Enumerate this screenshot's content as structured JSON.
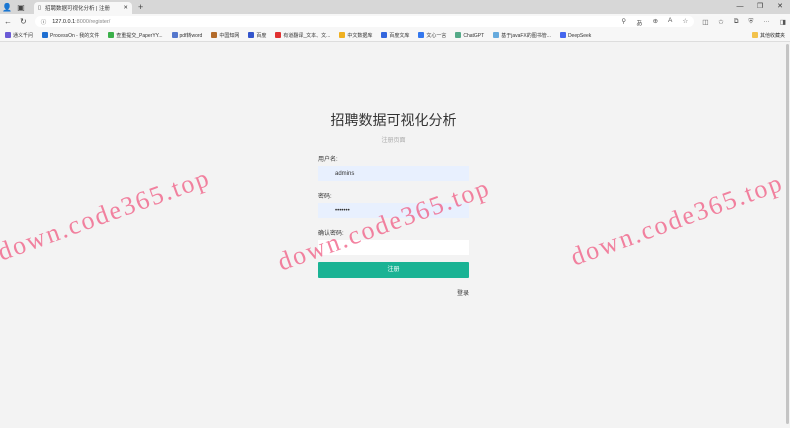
{
  "browser": {
    "tab_title": "招聘数据可视化分析 | 注册",
    "url_host": "127.0.0.1",
    "url_path": ":8000/register/",
    "bookmarks": [
      {
        "label": "通义千问",
        "color": "#6b5bd6"
      },
      {
        "label": "ProcessOn - 我的文件",
        "color": "#1f6fd1"
      },
      {
        "label": "查重提交_PaperYY...",
        "color": "#3bb04a"
      },
      {
        "label": "pdf转word",
        "color": "#5577cc"
      },
      {
        "label": "中国知网",
        "color": "#b36b2b"
      },
      {
        "label": "百度",
        "color": "#3355cc"
      },
      {
        "label": "有道翻译_文本、文...",
        "color": "#e03030"
      },
      {
        "label": "中文数据库",
        "color": "#f0b020"
      },
      {
        "label": "百度文库",
        "color": "#3366dd"
      },
      {
        "label": "文心一言",
        "color": "#3377ee"
      },
      {
        "label": "ChatGPT",
        "color": "#55aa88"
      },
      {
        "label": "基于javaFX的图书管...",
        "color": "#66aadd"
      },
      {
        "label": "DeepSeek",
        "color": "#4466ee"
      }
    ],
    "other_bookmarks": "其他收藏夹"
  },
  "form": {
    "title": "招聘数据可视化分析",
    "subtitle": "注册页面",
    "username_label": "用户名:",
    "username_value": "admins",
    "password_label": "密码:",
    "password_value": "•••••••",
    "confirm_label": "确认密码:",
    "confirm_value": "",
    "submit": "注册",
    "login_link": "登录"
  },
  "watermark": "down.code365.top"
}
